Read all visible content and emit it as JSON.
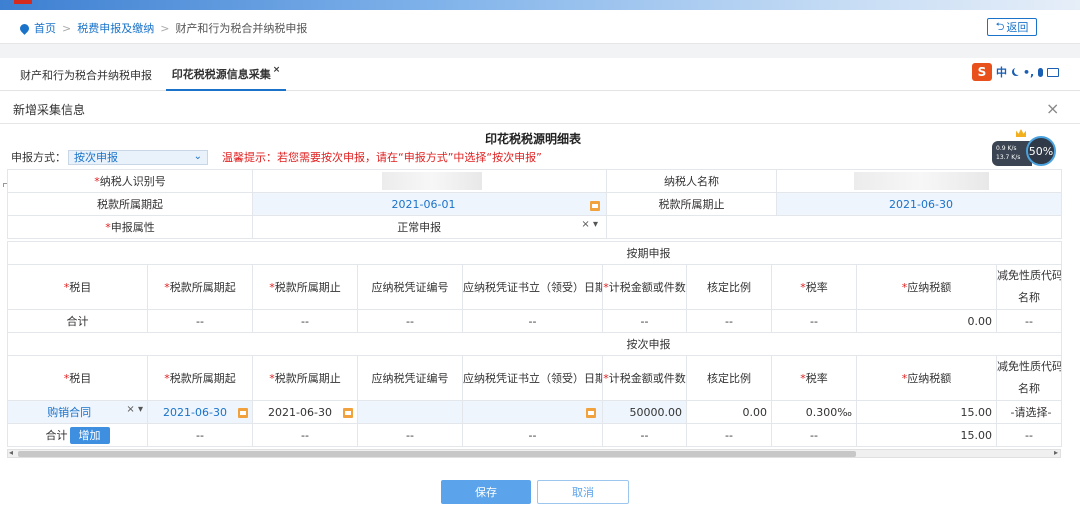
{
  "breadcrumb": {
    "home": "首页",
    "level1": "税费申报及缴纳",
    "current": "财产和行为税合并纳税申报",
    "back_label": "返回"
  },
  "tabs": [
    {
      "label": "财产和行为税合并纳税申报",
      "active": false
    },
    {
      "label": "印花税税源信息采集",
      "active": true,
      "close": "×"
    }
  ],
  "ime": {
    "logo": "S",
    "lang": "中",
    "dot": "•,"
  },
  "speed_widget": {
    "up": "0.9 K/s",
    "down": "13.7 K/s",
    "percent": "50%"
  },
  "panel": {
    "title": "新增采集信息",
    "close": "×",
    "form_title": "印花税税源明细表",
    "mode_label": "申报方式：",
    "mode_value": "按次申报",
    "tip": "温馨提示：若您需要按次申报，请在“申报方式”中选择“按次申报”"
  },
  "basic_info": {
    "taxpayer_id_label": "纳税人识别号",
    "taxpayer_name_label": "纳税人名称",
    "period_start_label": "税款所属期起",
    "period_start_value": "2021-06-01",
    "period_end_label": "税款所属期止",
    "period_end_value": "2021-06-30",
    "attr_label": "申报属性",
    "attr_value": "正常申报",
    "attr_clear": "×"
  },
  "section_periodic": {
    "title": "按期申报",
    "columns": [
      "税目",
      "税款所属期起",
      "税款所属期止",
      "应纳税凭证编号",
      "应纳税凭证书立（领受）日期",
      "计税金额或件数",
      "核定比例",
      "税率",
      "应纳税额",
      "减免性质代码",
      "名称"
    ],
    "total_row": {
      "label": "合计",
      "c1": "--",
      "c2": "--",
      "c3": "--",
      "c4": "--",
      "c5": "--",
      "c6": "--",
      "c7": "--",
      "tax": "0.00",
      "c9": "--"
    }
  },
  "section_per_time": {
    "title": "按次申报",
    "row": {
      "item": "购销合同",
      "start": "2021-06-30",
      "end": "2021-06-30",
      "voucher_no": "",
      "amount": "50000.00",
      "ratio": "0.00",
      "rate": "0.300‰",
      "tax": "15.00",
      "relief": "-请选择-"
    },
    "total_row": {
      "label": "合计",
      "add_label": "增加",
      "c1": "--",
      "c2": "--",
      "c3": "--",
      "c4": "--",
      "c5": "--",
      "c6": "--",
      "c7": "--",
      "tax": "15.00",
      "c9": "--"
    }
  },
  "buttons": {
    "save": "保存",
    "cancel": "取消"
  }
}
